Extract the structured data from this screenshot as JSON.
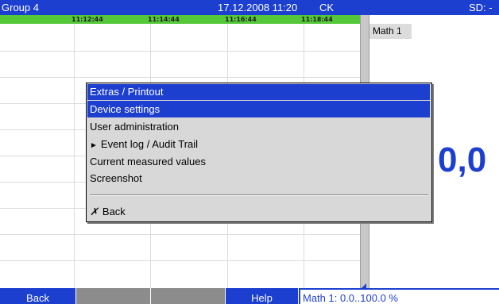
{
  "header": {
    "group": "Group 4",
    "datetime": "17.12.2008 11:20",
    "user": "CK",
    "sd": "SD: -"
  },
  "time_axis": {
    "ticks": [
      "11:12:44",
      "11:14:44",
      "11:16:44",
      "11:18:44"
    ]
  },
  "right_panel": {
    "channel_name": "Math 1",
    "value": "0,0"
  },
  "menu": {
    "title": "Extras / Printout",
    "items": [
      {
        "label": "Device settings",
        "selected": true
      },
      {
        "label": "User administration",
        "selected": false
      },
      {
        "label": "Event log / Audit Trail",
        "selected": false,
        "submenu_icon": "play-arrow-icon"
      },
      {
        "label": "Current measured values",
        "selected": false
      },
      {
        "label": "Screenshot",
        "selected": false
      }
    ],
    "back_label": "Back",
    "back_icon": "x-icon"
  },
  "bottom_bar": {
    "softkeys": [
      "Back",
      "",
      "",
      "Help"
    ],
    "status": "Math 1: 0.0..100.0 %"
  },
  "colors": {
    "accent_blue": "#1d3fd0",
    "time_strip_green": "#55c83a",
    "empty_softkey_gray": "#8c8c8c",
    "menu_background": "#d8d8d8"
  }
}
